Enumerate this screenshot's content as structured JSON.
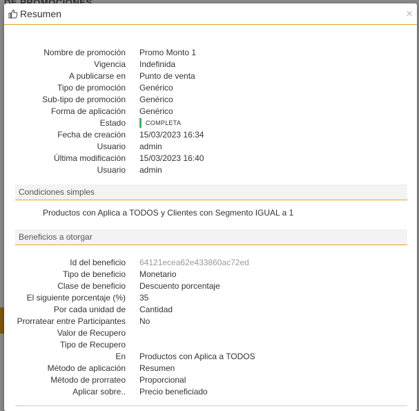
{
  "background": {
    "title": "DE PROMOCIONES"
  },
  "modal": {
    "title": "Resumen",
    "close_label": "×"
  },
  "summary": [
    {
      "key": "Nombre de promoción",
      "value": "Promo Monto 1"
    },
    {
      "key": "Vigencia",
      "value": "Indefinida"
    },
    {
      "key": "A publicarse en",
      "value": "Punto de venta"
    },
    {
      "key": "Tipo de promoción",
      "value": "Genérico"
    },
    {
      "key": "Sub-tipo de promoción",
      "value": "Genérico"
    },
    {
      "key": "Forma de aplicación",
      "value": "Genérico"
    },
    {
      "key": "Estado",
      "value": "COMPLETA"
    },
    {
      "key": "Fecha de creación",
      "value": "15/03/2023 16:34"
    },
    {
      "key": "Usuario",
      "value": "admin"
    },
    {
      "key": "Última modificación",
      "value": "15/03/2023 16:40"
    },
    {
      "key": "Usuario",
      "value": "admin"
    }
  ],
  "conditions": {
    "title": "Condiciones simples",
    "text": "Productos con Aplica a TODOS y Clientes con Segmento IGUAL a 1"
  },
  "benefits": {
    "title": "Beneficios a otorgar",
    "rows": [
      {
        "key": "Id del beneficio",
        "value": "64121ecea62e433860ac72ed"
      },
      {
        "key": "Tipo de beneficio",
        "value": "Monetario"
      },
      {
        "key": "Clase de beneficio",
        "value": "Descuento porcentaje"
      },
      {
        "key": "El siguiente porcentaje (%)",
        "value": "35"
      },
      {
        "key": "Por cada unidad de",
        "value": "Cantidad"
      },
      {
        "key": "Prorratear entre Participantes",
        "value": "No"
      },
      {
        "key": "Valor de Recupero",
        "value": ""
      },
      {
        "key": "Tipo de Recupero",
        "value": ""
      },
      {
        "key": "En",
        "value": "Productos con Aplica a TODOS"
      },
      {
        "key": "Método de aplicación",
        "value": "Resumen"
      },
      {
        "key": "Método de prorrateo",
        "value": "Proporcional"
      },
      {
        "key": "Aplicar sobre..",
        "value": "Precio beneficiado"
      }
    ]
  },
  "colors": {
    "accent": "#e8a317",
    "status_complete": "#3cb371",
    "muted_value": "#999999"
  },
  "icons": {
    "title_icon": "thumbs-up-icon",
    "close_icon": "close-icon"
  }
}
